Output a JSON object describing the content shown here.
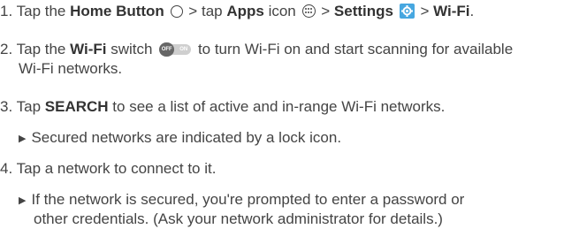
{
  "step1": {
    "number": "1.",
    "text_1": "Tap the",
    "home_button": "Home Button",
    "text_2": ">",
    "text_3": "tap",
    "apps": "Apps",
    "text_4": "icon",
    "text_5": ">",
    "settings": "Settings",
    "text_6": ">",
    "wifi": "Wi-Fi",
    "text_end": "."
  },
  "step2": {
    "number": "2.",
    "text_1": "Tap the",
    "wifi": "Wi-Fi",
    "text_2": "switch",
    "text_3": "to turn Wi-Fi on and start scanning for available",
    "line2": "Wi-Fi networks.",
    "toggle_off": "OFF",
    "toggle_on": "ON"
  },
  "step3": {
    "number": "3.",
    "text_1": "Tap",
    "search": "SEARCH",
    "text_2": "to see a list of active and in-range Wi-Fi networks.",
    "bullet": "Secured networks are indicated by a lock icon."
  },
  "step4": {
    "number": "4.",
    "text": "Tap a network to connect to it.",
    "bullet_line1": "If the network is secured, you're prompted to enter a password or",
    "bullet_line2": "other credentials. (Ask your network administrator for details.)"
  },
  "colors": {
    "settings_icon": "#47a7e0",
    "text": "#444444",
    "toggle_track": "#cfcfcf"
  },
  "icons": [
    "home-button-circle-icon",
    "apps-icon",
    "settings-icon",
    "wifi-toggle-switch-icon",
    "bullet-triangle-icon"
  ]
}
